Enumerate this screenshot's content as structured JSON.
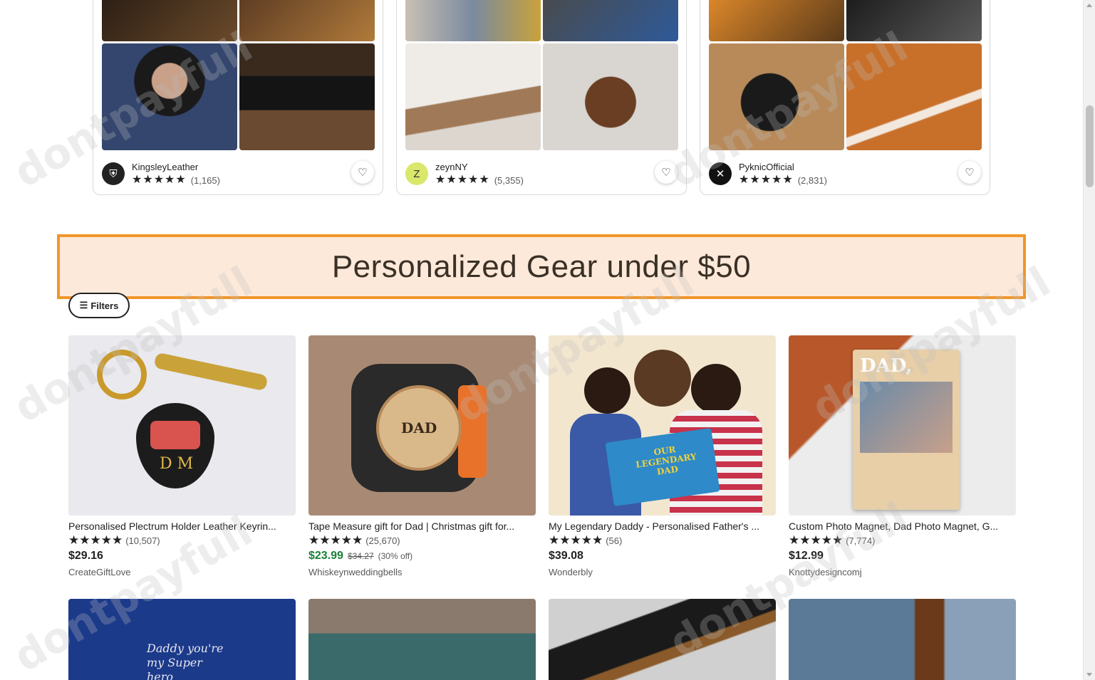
{
  "shops": [
    {
      "name": "KingsleyLeather",
      "stars": "★★★★★",
      "count": "(1,165)",
      "avatar_icon": "shield-logo",
      "avatar_glyph": "⛨",
      "avatar_bg": "#222222",
      "avatar_fg": "#ffffff",
      "tiles": [
        "#3b2a1e",
        "#7a5a3a",
        "#4a5a7a",
        "#5a3a22"
      ]
    },
    {
      "name": "zeynNY",
      "stars": "★★★★★",
      "count": "(5,355)",
      "avatar_icon": "letter-logo",
      "avatar_glyph": "Z",
      "avatar_bg": "#d9e86a",
      "avatar_fg": "#333333",
      "tiles": [
        "#b8a08a",
        "#3b5a8a",
        "#e6e2dc",
        "#d8d4d0"
      ]
    },
    {
      "name": "PyknicOfficial",
      "stars": "★★★★★",
      "count": "(2,831)",
      "avatar_icon": "crossed-utensils-logo",
      "avatar_glyph": "✕",
      "avatar_bg": "#111111",
      "avatar_fg": "#ffffff",
      "tiles": [
        "#c8782a",
        "#2a2a2a",
        "#b07a4a",
        "#c06a2a"
      ]
    }
  ],
  "heart_icon": "♡",
  "section": {
    "title": "Personalized Gear under $50"
  },
  "filters": {
    "label": "Filters",
    "icon": "☰"
  },
  "listings": [
    {
      "title": "Personalised Plectrum Holder Leather Keyrin...",
      "stars": "★★★★★",
      "count": "(10,507)",
      "price": "$29.16",
      "orig_price": "",
      "discount": "",
      "seller": "CreateGiftLove",
      "img_bg": "#e9e9ee",
      "img_text": "D M"
    },
    {
      "title": "Tape Measure gift for Dad | Christmas gift for...",
      "stars": "★★★★★",
      "count": "(25,670)",
      "price": "$23.99",
      "orig_price": "$34.27",
      "discount": "(30% off)",
      "seller": "Whiskeynweddingbells",
      "img_bg": "#a88a74",
      "img_text": "DAD"
    },
    {
      "title": "My Legendary Daddy - Personalised Father's ...",
      "stars": "★★★★★",
      "count": "(56)",
      "price": "$39.08",
      "orig_price": "",
      "discount": "",
      "seller": "Wonderbly",
      "img_bg": "#f3e6cf",
      "img_text": "OUR LEGENDARY DAD"
    },
    {
      "title": "Custom Photo Magnet, Dad Photo Magnet, G...",
      "stars": "★★★★★",
      "count": "(7,774)",
      "price": "$12.99",
      "orig_price": "",
      "discount": "",
      "seller": "Knottydesigncomj",
      "img_bg": "#b8582a",
      "img_text": "DAD,"
    }
  ],
  "listings_row2": [
    {
      "img_bg": "#1c3a8a",
      "img_text": "Daddy you're my Super hero"
    },
    {
      "img_bg": "#7a7068",
      "img_text": ""
    },
    {
      "img_bg": "#c9c9c9",
      "img_text": ""
    },
    {
      "img_bg": "#6a8aa8",
      "img_text": ""
    }
  ],
  "watermark_text": "dontpayfull",
  "colors": {
    "accent_border": "#f0962b",
    "banner_bg": "#fde9d9",
    "sale_green": "#1a7f37"
  }
}
